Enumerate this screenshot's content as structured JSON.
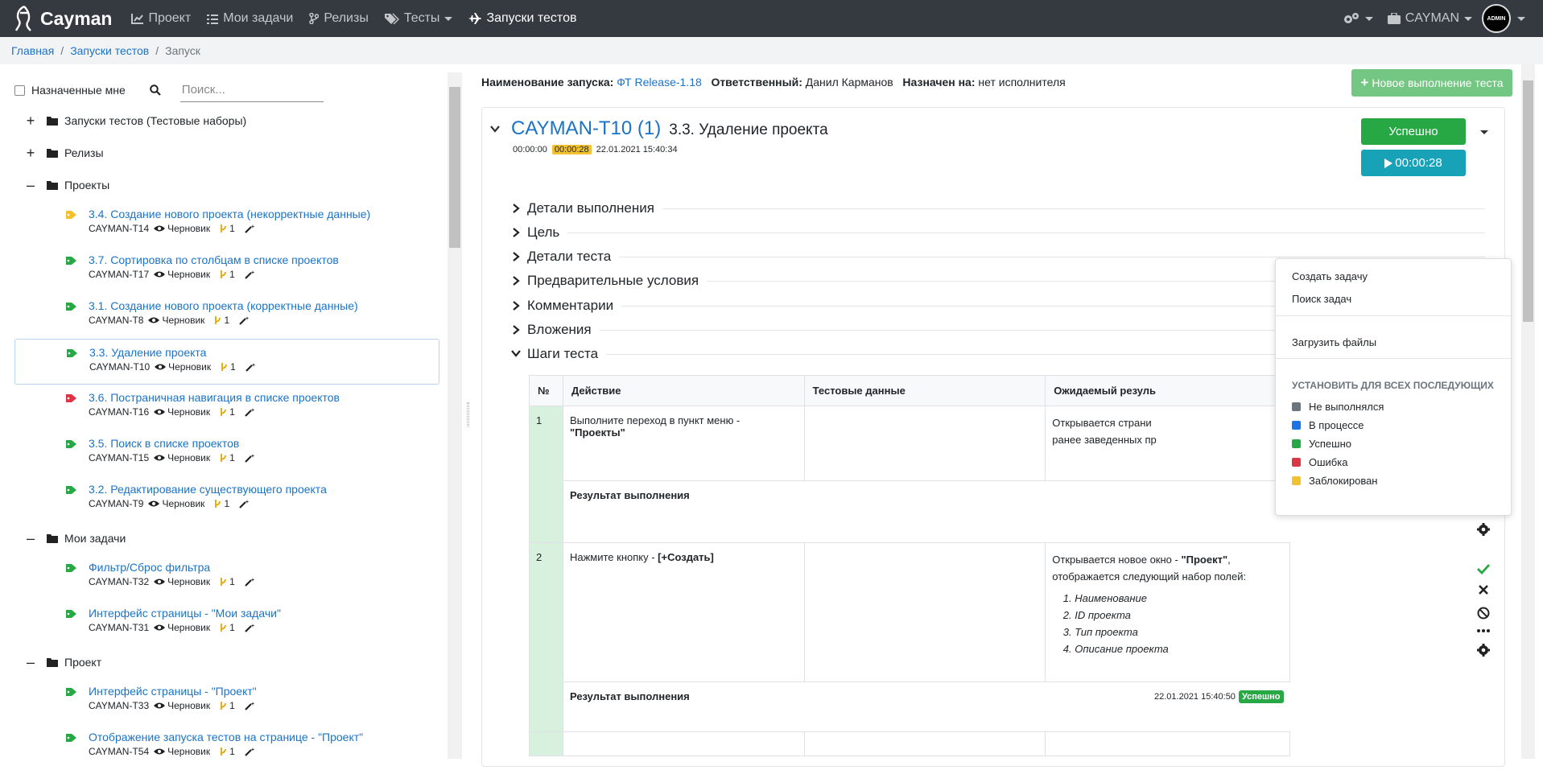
{
  "topbar": {
    "brand": "Cayman",
    "nav": [
      {
        "label": "Проект",
        "icon": "chart-icon"
      },
      {
        "label": "Мои задачи",
        "icon": "tasks-icon"
      },
      {
        "label": "Релизы",
        "icon": "branch-icon"
      },
      {
        "label": "Тесты",
        "icon": "tags-icon"
      },
      {
        "label": "Запуски тестов",
        "icon": "plane-icon"
      }
    ],
    "org": "CAYMAN",
    "avatar": "ADMIN"
  },
  "breadcrumb": {
    "items": [
      "Главная",
      "Запуски тестов"
    ],
    "current": "Запуск"
  },
  "filters": {
    "assigned_label": "Назначенные мне",
    "search_placeholder": "Поиск..."
  },
  "tree": {
    "folders": {
      "runs": "Запуски тестов (Тестовые наборы)",
      "releases": "Релизы",
      "projects": "Проекты",
      "mytasks": "Мои задачи",
      "project": "Проект"
    },
    "status_label": "Черновик",
    "version": "1",
    "projects_tests": [
      {
        "title": "3.4. Создание нового проекта (некорректные данные)",
        "key": "CAYMAN-T14",
        "color": "#f1c12e"
      },
      {
        "title": "3.7. Сортировка по столбцам в списке проектов",
        "key": "CAYMAN-T17",
        "color": "#28a745"
      },
      {
        "title": "3.1. Создание нового проекта (корректные данные)",
        "key": "CAYMAN-T8",
        "color": "#28a745"
      },
      {
        "title": "3.3. Удаление проекта",
        "key": "CAYMAN-T10",
        "color": "#28a745"
      },
      {
        "title": "3.6. Постраничная навигация в списке проектов",
        "key": "CAYMAN-T16",
        "color": "#dc3545"
      },
      {
        "title": "3.5. Поиск в списке проектов",
        "key": "CAYMAN-T15",
        "color": "#28a745"
      },
      {
        "title": "3.2. Редактирование существующего проекта",
        "key": "CAYMAN-T9",
        "color": "#28a745"
      }
    ],
    "mytasks_tests": [
      {
        "title": "Фильтр/Сброс фильтра",
        "key": "CAYMAN-T32",
        "color": "#28a745"
      },
      {
        "title": "Интерфейс страницы - \"Мои задачи\"",
        "key": "CAYMAN-T31",
        "color": "#28a745"
      }
    ],
    "project_tests": [
      {
        "title": "Интерфейс страницы - \"Проект\"",
        "key": "CAYMAN-T33",
        "color": "#28a745"
      },
      {
        "title": "Отображение запуска тестов на странице - \"Проект\"",
        "key": "CAYMAN-T54",
        "color": "#28a745"
      }
    ]
  },
  "run": {
    "name_label": "Наименование запуска:",
    "name": "ФТ Release-1.18",
    "resp_label": "Ответственный:",
    "resp": "Данил Карманов",
    "assigned_label": "Назначен на:",
    "assigned": "нет исполнителя",
    "new_button": "Новое выполнение теста"
  },
  "testcase": {
    "id": "CAYMAN-T10 (1)",
    "name": "3.3. Удаление проекта",
    "t1": "00:00:00",
    "t2": "00:00:28",
    "date": "22.01.2021 15:40:34",
    "status_button": "Успешно",
    "timer_button": "00:00:28",
    "sections": [
      "Детали выполнения",
      "Цель",
      "Детали теста",
      "Предварительные условия",
      "Комментарии",
      "Вложения",
      "Шаги теста"
    ]
  },
  "steps": {
    "headers": [
      "№",
      "Действие",
      "Тестовые данные",
      "Ожидаемый резуль"
    ],
    "result_label": "Результат выполнения",
    "rows": [
      {
        "n": "1",
        "action": "Выполните переход в пункт меню - ",
        "action_bold": "\"Проекты\"",
        "expected1": "Открывается страни",
        "expected2": "ранее заведенных пр"
      },
      {
        "n": "2",
        "action": "Нажмите кнопку - ",
        "action_bold": "[+Создать]",
        "expected_pre": "Открывается новое окно - ",
        "expected_bold": "\"Проект\"",
        "expected_post": ", отображается следующий набор полей:",
        "list": [
          "Наименование",
          "ID проекта",
          "Тип проекта",
          "Описание проекта"
        ],
        "result_date": "22.01.2021 15:40:50",
        "result_status": "Успешно"
      }
    ]
  },
  "menu": {
    "create": "Создать задачу",
    "search": "Поиск задач",
    "upload": "Загрузить файлы",
    "set_all": "УСТАНОВИТЬ ДЛЯ ВСЕХ ПОСЛЕДУЮЩИХ",
    "statuses": [
      {
        "label": "Не выполнялся",
        "color": "#6c757d"
      },
      {
        "label": "В процессе",
        "color": "#1a73e8"
      },
      {
        "label": "Успешно",
        "color": "#28a745"
      },
      {
        "label": "Ошибка",
        "color": "#dc3545"
      },
      {
        "label": "Заблокирован",
        "color": "#f1c12e"
      }
    ]
  }
}
